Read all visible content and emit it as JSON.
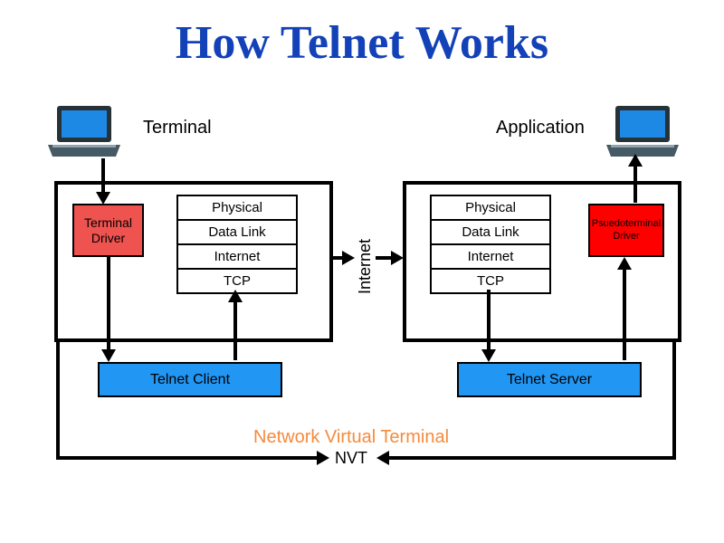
{
  "title": "How Telnet Works",
  "left_label": "Terminal",
  "right_label": "Application",
  "left_driver": "Terminal Driver",
  "right_driver": "Psuedoterminal Driver",
  "stack": {
    "l0": "Physical",
    "l1": "Data Link",
    "l2": "Internet",
    "l3": "TCP"
  },
  "internet": "Internet",
  "telnet_client": "Telnet Client",
  "telnet_server": "Telnet Server",
  "nvt_long": "Network Virtual Terminal",
  "nvt_short": "NVT"
}
